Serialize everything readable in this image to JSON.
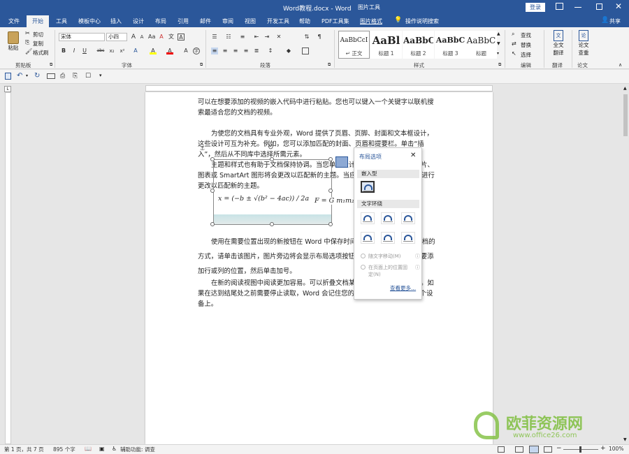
{
  "window": {
    "title": "Word教程.docx  -  Word",
    "context_tab_group": "图片工具",
    "login_label": "登录",
    "share_label": "共享"
  },
  "tabs": [
    "文件",
    "开始",
    "工具",
    "模板中心",
    "插入",
    "设计",
    "布局",
    "引用",
    "邮件",
    "审阅",
    "视图",
    "开发工具",
    "帮助",
    "PDF工具集",
    "图片格式"
  ],
  "active_tab": "开始",
  "tell_me": "操作说明搜索",
  "ribbon": {
    "clipboard": {
      "paste": "粘贴",
      "cut": "剪切",
      "copy": "复制",
      "format_painter": "格式刷",
      "label": "剪贴板"
    },
    "font": {
      "name": "宋体",
      "size": "小四",
      "label": "字体",
      "bold": "B",
      "italic": "I",
      "underline": "U",
      "strike": "abc",
      "sub": "x₂",
      "sup": "x²",
      "grow": "A",
      "shrink": "A",
      "font_color": "A",
      "highlight": "A"
    },
    "paragraph": {
      "label": "段落"
    },
    "styles": {
      "label": "样式",
      "items": [
        {
          "sample": "AaBbCcI",
          "name": "↵ 正文"
        },
        {
          "sample": "AaBl",
          "name": "标题 1"
        },
        {
          "sample": "AaBbC",
          "name": "标题 2"
        },
        {
          "sample": "AaBbC",
          "name": "标题 3"
        },
        {
          "sample": "AaBbC",
          "name": "标题"
        }
      ]
    },
    "editing": {
      "find": "查找",
      "replace": "替换",
      "select": "选择",
      "label": "编辑"
    },
    "translate": {
      "btn1": "全文",
      "btn2": "翻译",
      "label": "翻译"
    },
    "paper": {
      "btn1": "论文",
      "btn2": "查重",
      "label": "论文"
    }
  },
  "document": {
    "p1": "可以在想要添加的视频的嵌入代码中进行粘贴。您也可以键入一个关键字以联机搜索最适合您的文档的视频。",
    "p2": "为使您的文档具有专业外观，Word 提供了页眉、页脚、封面和文本框设计，这些设计可互为补充。例如，您可以添加匹配的封面、页眉和提要栏。单击“插入”，然后从不同库中选择所需元素。",
    "p3": "主题和样式也有助于文档保持协调。当您单击设计并选择新的主题时，图片、图表或 SmartArt 图形将会更改以匹配新的主题。当应用样式时，您的标题会进行更改以匹配新的主题。",
    "formula1": "x = (−b ± √(b² − 4ac)) / 2a",
    "formula2": "F = G m₁m₂ / r²",
    "p4": "使用在需要位置出现的新按钮在 Word 中保存时间。若要更改图片适应文档的方式，请单击该图片，图片旁边将会显示布局选项按钮。当处理表格时，单击要添加行或列的位置，然后单击加号。",
    "p5": "在新的阅读视图中阅读更加容易。可以折叠文档某些部分并关注所需文本。如果在达到结尾处之前需要停止读取，Word 会记住您的停止位置 - 即使在另一个设备上。"
  },
  "layout_panel": {
    "title": "布局选项",
    "inline_label": "嵌入型",
    "wrap_label": "文字环绕",
    "option1": "随文字移动(M)",
    "option2": "在页面上的位置固定(N)",
    "more": "查看更多..."
  },
  "status": {
    "page": "第 1 页，共 7 页",
    "words": "895 个字",
    "accessibility": "辅助功能: 调查",
    "zoom": "100%"
  },
  "watermark": {
    "text": "欧菲资源网",
    "url": "www.office26.com"
  },
  "colors": {
    "brand": "#2b579a",
    "watermark": "#7fbf3f"
  }
}
